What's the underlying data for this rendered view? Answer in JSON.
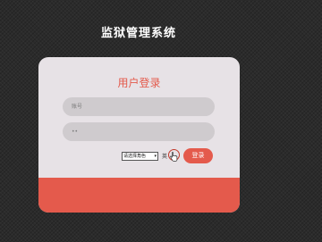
{
  "app": {
    "title": "监狱管理系统"
  },
  "login": {
    "heading": "用户登录",
    "account_placeholder": "账号",
    "password_value": "••",
    "role_select_value": "请选择角色",
    "lang_link": "英",
    "submit_label": "登录"
  },
  "colors": {
    "accent": "#e45a4c",
    "card_bg": "#e7e2e6",
    "field_bg": "#cfcbce",
    "page_bg": "#2b2b2b"
  },
  "icons": {
    "cursor": "hand-pointer-icon",
    "dropdown": "chevron-down-icon"
  }
}
